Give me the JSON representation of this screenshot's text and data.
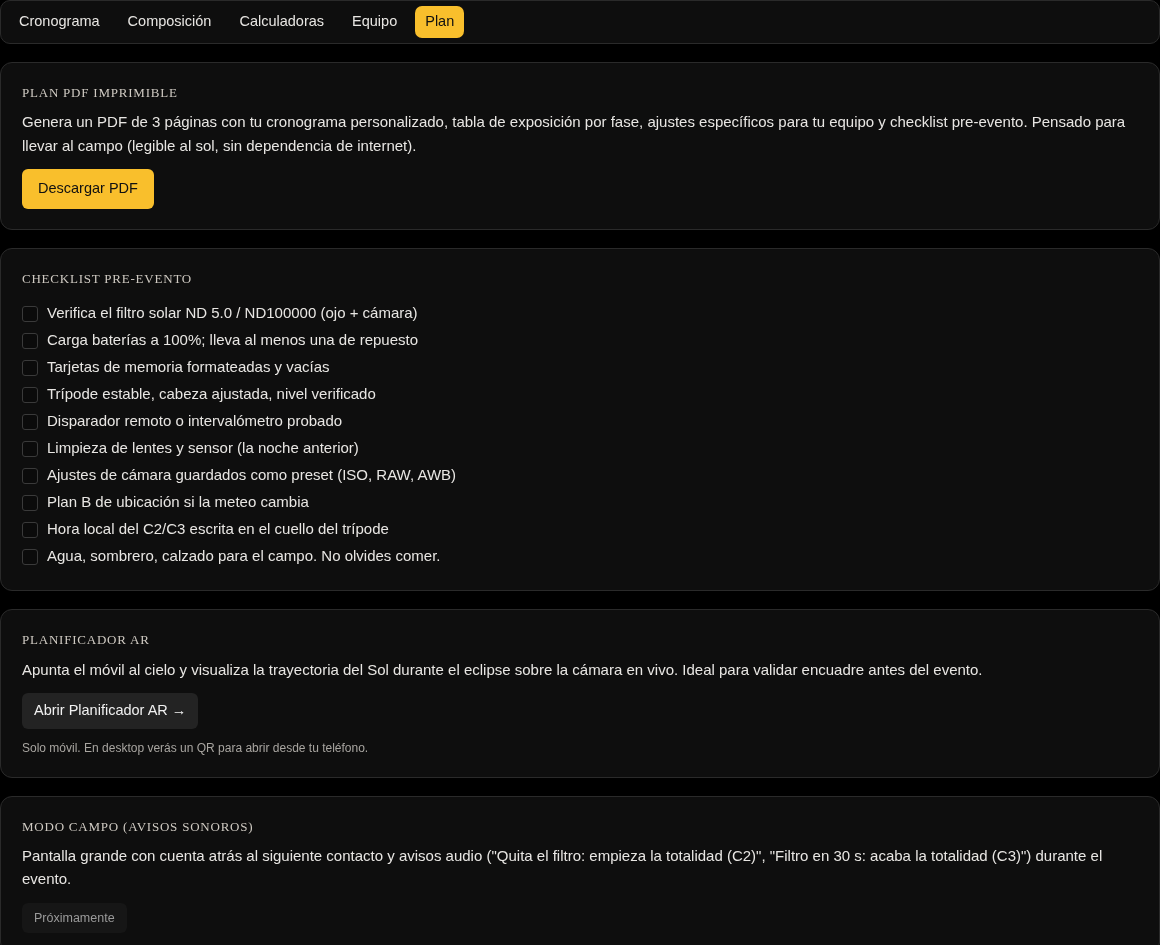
{
  "tabs": [
    {
      "label": "Cronograma",
      "selected": false
    },
    {
      "label": "Composición",
      "selected": false
    },
    {
      "label": "Calculadoras",
      "selected": false
    },
    {
      "label": "Equipo",
      "selected": false
    },
    {
      "label": "Plan",
      "selected": true
    }
  ],
  "sections": [
    {
      "title": "PLAN PDF IMPRIMIBLE",
      "text": "Genera un PDF de 3 páginas con tu cronograma personalizado, tabla de exposición por fase, ajustes específicos para tu equipo y checklist pre-evento. Pensado para llevar al campo (legible al sol, sin dependencia de internet).",
      "button": {
        "label": "Descargar PDF",
        "kind": "primary",
        "disabled": false
      }
    },
    {
      "title": "CHECKLIST PRE-EVENTO",
      "items": [
        {
          "label": "Verifica el filtro solar ND 5.0 / ND100000 (ojo + cámara)",
          "checked": false
        },
        {
          "label": "Carga baterías a 100%; lleva al menos una de repuesto",
          "checked": false
        },
        {
          "label": "Tarjetas de memoria formateadas y vacías",
          "checked": false
        },
        {
          "label": "Trípode estable, cabeza ajustada, nivel verificado",
          "checked": false
        },
        {
          "label": "Disparador remoto o intervalómetro probado",
          "checked": false
        },
        {
          "label": "Limpieza de lentes y sensor (la noche anterior)",
          "checked": false
        },
        {
          "label": "Ajustes de cámara guardados como preset (ISO, RAW, AWB)",
          "checked": false
        },
        {
          "label": "Plan B de ubicación si la meteo cambia",
          "checked": false
        },
        {
          "label": "Hora local del C2/C3 escrita en el cuello del trípode",
          "checked": false
        },
        {
          "label": "Agua, sombrero, calzado para el campo. No olvides comer.",
          "checked": false
        }
      ]
    },
    {
      "title": "PLANIFICADOR AR",
      "text": "Apunta el móvil al cielo y visualiza la trayectoria del Sol durante el eclipse sobre la cámara en vivo. Ideal para validar encuadre antes del evento.",
      "button": {
        "label": "Abrir Planificador AR →",
        "kind": "secondary",
        "disabled": false
      },
      "note": "Solo móvil. En desktop verás un QR para abrir desde tu teléfono."
    },
    {
      "title": "MODO CAMPO (AVISOS SONOROS)",
      "text": "Pantalla grande con cuenta atrás al siguiente contacto y avisos audio (\"Quita el filtro: empieza la totalidad (C2)\", \"Filtro en 30 s: acaba la totalidad (C3)\") durante el evento.",
      "button": {
        "label": "Próximamente",
        "kind": "secondary",
        "disabled": true
      }
    }
  ]
}
